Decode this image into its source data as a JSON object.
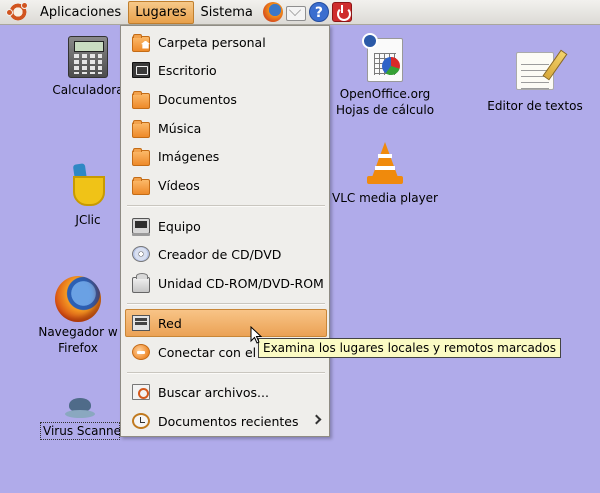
{
  "panel": {
    "menus": [
      {
        "label": "Aplicaciones"
      },
      {
        "label": "Lugares"
      },
      {
        "label": "Sistema"
      }
    ],
    "launchers": [
      {
        "icon": "firefox-icon"
      },
      {
        "icon": "mail-icon"
      },
      {
        "icon": "help-icon",
        "glyph": "?"
      },
      {
        "icon": "power-icon"
      }
    ]
  },
  "desktop": {
    "background_color": "#b0abea",
    "icons": [
      {
        "label": "Calculadora",
        "icon": "calculator-icon"
      },
      {
        "label": "JClic",
        "icon": "jclic-icon"
      },
      {
        "label_line1": "Navegador w",
        "label_line2": "Firefox",
        "icon": "firefox-icon"
      },
      {
        "label": "Virus Scanne",
        "icon": "virus-scanner-icon"
      },
      {
        "label_line1": "OpenOffice.org",
        "label_line2": "Hojas de cálculo",
        "icon": "spreadsheet-icon"
      },
      {
        "label": "VLC media player",
        "icon": "vlc-icon"
      },
      {
        "label": "Editor de textos",
        "icon": "text-editor-icon"
      }
    ]
  },
  "places_menu": {
    "items": [
      {
        "label": "Carpeta personal",
        "icon": "home-folder-icon"
      },
      {
        "label": "Escritorio",
        "icon": "desktop-icon"
      },
      {
        "label": "Documentos",
        "icon": "folder-icon"
      },
      {
        "label": "Música",
        "icon": "folder-icon"
      },
      {
        "label": "Imágenes",
        "icon": "folder-icon"
      },
      {
        "label": "Vídeos",
        "icon": "folder-icon"
      },
      {
        "label": "Equipo",
        "icon": "computer-icon"
      },
      {
        "label": "Creador de CD/DVD",
        "icon": "cd-icon"
      },
      {
        "label": "Unidad CD-ROM/DVD-ROM",
        "icon": "cdrom-drive-icon"
      },
      {
        "label": "Red",
        "icon": "network-icon",
        "highlighted": true
      },
      {
        "label": "Conectar con el s",
        "icon": "connect-server-icon"
      },
      {
        "label": "Buscar archivos...",
        "icon": "search-files-icon"
      },
      {
        "label": "Documentos recientes",
        "icon": "recent-documents-icon",
        "has_submenu": true
      }
    ]
  },
  "tooltip": {
    "text": "Examina los lugares locales y remotos marcados"
  },
  "colors": {
    "menu_highlight": "#eba255",
    "tooltip_bg": "#fbfbc4"
  }
}
